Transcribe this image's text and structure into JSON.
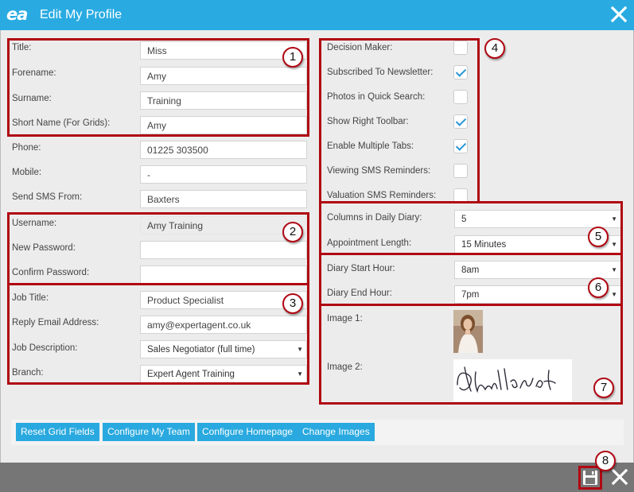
{
  "window": {
    "logo": "ea",
    "title": "Edit My Profile"
  },
  "left": {
    "title": {
      "label": "Title:",
      "value": "Miss"
    },
    "forename": {
      "label": "Forename:",
      "value": "Amy"
    },
    "surname": {
      "label": "Surname:",
      "value": "Training"
    },
    "short_name": {
      "label": "Short Name (For Grids):",
      "value": "Amy"
    },
    "phone": {
      "label": "Phone:",
      "value": "01225 303500"
    },
    "mobile": {
      "label": "Mobile:",
      "value": "-"
    },
    "sms_from": {
      "label": "Send SMS From:",
      "value": "Baxters"
    },
    "username": {
      "label": "Username:",
      "value": "Amy Training"
    },
    "new_password": {
      "label": "New Password:",
      "value": ""
    },
    "confirm_password": {
      "label": "Confirm Password:",
      "value": ""
    },
    "job_title": {
      "label": "Job Title:",
      "value": "Product Specialist"
    },
    "reply_email": {
      "label": "Reply Email Address:",
      "value": "amy@expertagent.co.uk"
    },
    "job_description": {
      "label": "Job Description:",
      "value": "Sales Negotiator (full time)"
    },
    "branch": {
      "label": "Branch:",
      "value": "Expert Agent Training"
    }
  },
  "right": {
    "checks": [
      {
        "label": "Decision Maker:",
        "checked": false
      },
      {
        "label": "Subscribed To Newsletter:",
        "checked": true
      },
      {
        "label": "Photos in Quick Search:",
        "checked": false
      },
      {
        "label": "Show Right Toolbar:",
        "checked": true
      },
      {
        "label": "Enable Multiple Tabs:",
        "checked": true
      },
      {
        "label": "Viewing SMS Reminders:",
        "checked": false
      },
      {
        "label": "Valuation SMS Reminders:",
        "checked": false
      }
    ],
    "columns_daily_diary": {
      "label": "Columns in Daily Diary:",
      "value": "5"
    },
    "appointment_length": {
      "label": "Appointment Length:",
      "value": "15 Minutes"
    },
    "diary_start": {
      "label": "Diary Start Hour:",
      "value": "8am"
    },
    "diary_end": {
      "label": "Diary End Hour:",
      "value": "7pm"
    },
    "image1": {
      "label": "Image 1:"
    },
    "image2": {
      "label": "Image 2:"
    }
  },
  "buttons": {
    "reset": "Reset Grid Fields",
    "team": "Configure My Team",
    "homepage": "Configure Homepage",
    "images": "Change Images"
  },
  "badges": [
    "1",
    "2",
    "3",
    "4",
    "5",
    "6",
    "7",
    "8"
  ],
  "icons": {
    "close": "close-icon",
    "save": "floppy-disk-icon",
    "dropdown": "triangle-down-icon"
  },
  "colors": {
    "titlebar": "#29abe2",
    "button": "#29a9df",
    "highlight": "#b00712",
    "footer": "#767676",
    "check": "#2a96d6"
  }
}
